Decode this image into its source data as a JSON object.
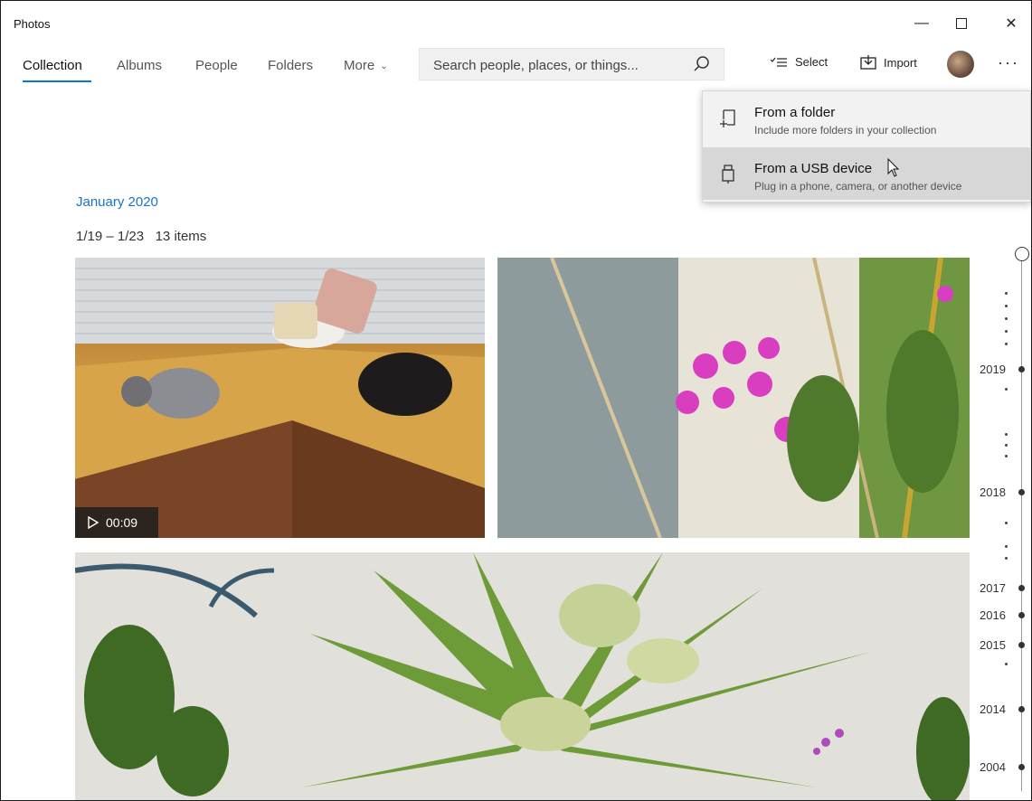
{
  "window": {
    "title": "Photos",
    "controls": {
      "minimize": "—",
      "maximize": "☐",
      "close": "✕"
    }
  },
  "nav": {
    "tabs": [
      {
        "label": "Collection",
        "active": true
      },
      {
        "label": "Albums"
      },
      {
        "label": "People"
      },
      {
        "label": "Folders"
      },
      {
        "label": "More"
      }
    ]
  },
  "search": {
    "placeholder": "Search people, places, or things..."
  },
  "toolbar": {
    "select_label": "Select",
    "import_label": "Import",
    "more_label": "···"
  },
  "import_menu": {
    "items": [
      {
        "title": "From a folder",
        "subtitle": "Include more folders in your collection",
        "icon": "folder-add-icon"
      },
      {
        "title": "From a USB device",
        "subtitle": "Plug in a phone, camera, or another device",
        "icon": "usb-icon",
        "hover": true
      }
    ]
  },
  "collection": {
    "month": "January 2020",
    "date_range": "1/19 – 1/23",
    "item_count": "13 items",
    "video_duration": "00:09"
  },
  "timeline": {
    "years": [
      "2019",
      "2018",
      "2017",
      "2016",
      "2015",
      "2014",
      "2004"
    ]
  }
}
